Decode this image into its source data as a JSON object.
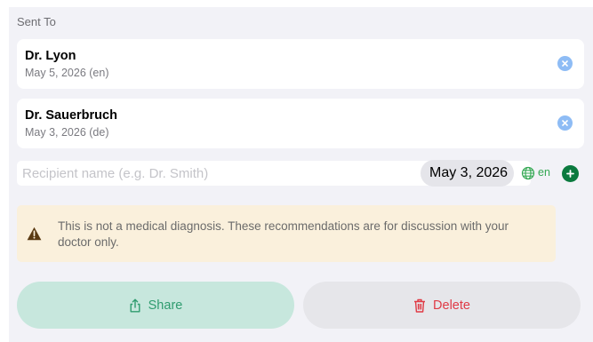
{
  "section": {
    "title": "Sent To"
  },
  "recipients": [
    {
      "name": "Dr. Lyon",
      "detail": "May 5, 2026 (en)"
    },
    {
      "name": "Dr. Sauerbruch",
      "detail": "May 3, 2026 (de)"
    }
  ],
  "new_recipient": {
    "placeholder": "Recipient name (e.g. Dr. Smith)",
    "value": "",
    "date": "May 3, 2026",
    "language": "en"
  },
  "notice": {
    "text": "This is not a medical diagnosis. These recommendations are for discussion with your doctor only.",
    "icon": "warning-icon"
  },
  "actions": {
    "share_label": "Share",
    "delete_label": "Delete"
  },
  "colors": {
    "remove": "#8ebcf5",
    "add": "#0b7a3e",
    "share_bg": "#c7e7dd",
    "share_text": "#2f9c6f",
    "delete_text": "#e03a45",
    "notice_bg": "#faf0dc"
  }
}
